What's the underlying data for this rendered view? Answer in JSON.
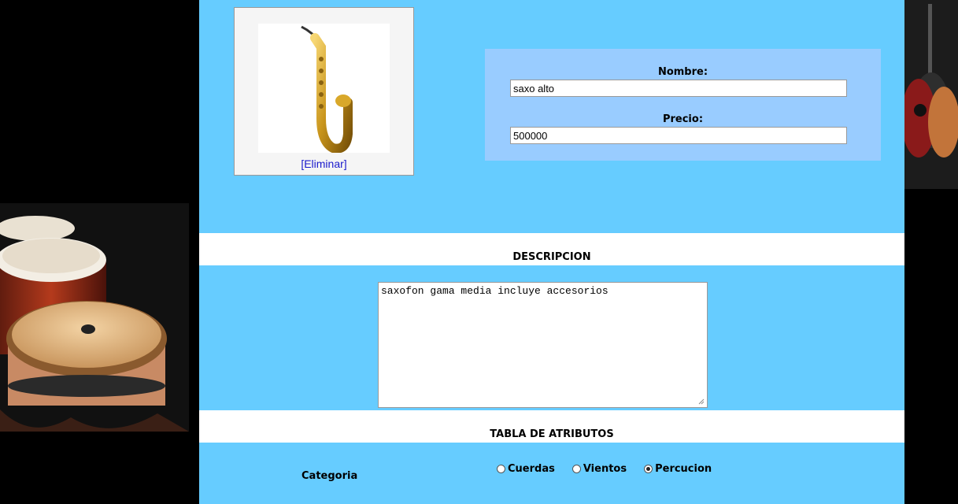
{
  "product": {
    "image_alt": "saxofon",
    "delete_link": "[Eliminar]"
  },
  "form": {
    "name_label": "Nombre:",
    "name_value": "saxo alto",
    "price_label": "Precio:",
    "price_value": "500000"
  },
  "description": {
    "heading": "DESCRIPCION",
    "text": "saxofon gama media incluye accesorios"
  },
  "attributes": {
    "heading": "TABLA DE ATRIBUTOS",
    "category_label": "Categoria",
    "options": [
      {
        "label": "Cuerdas",
        "selected": false
      },
      {
        "label": "Vientos",
        "selected": false
      },
      {
        "label": "Percucion",
        "selected": true
      }
    ]
  },
  "colors": {
    "main_bg": "#66ccff",
    "form_bg": "#99ccff",
    "link": "#1a1acc"
  }
}
